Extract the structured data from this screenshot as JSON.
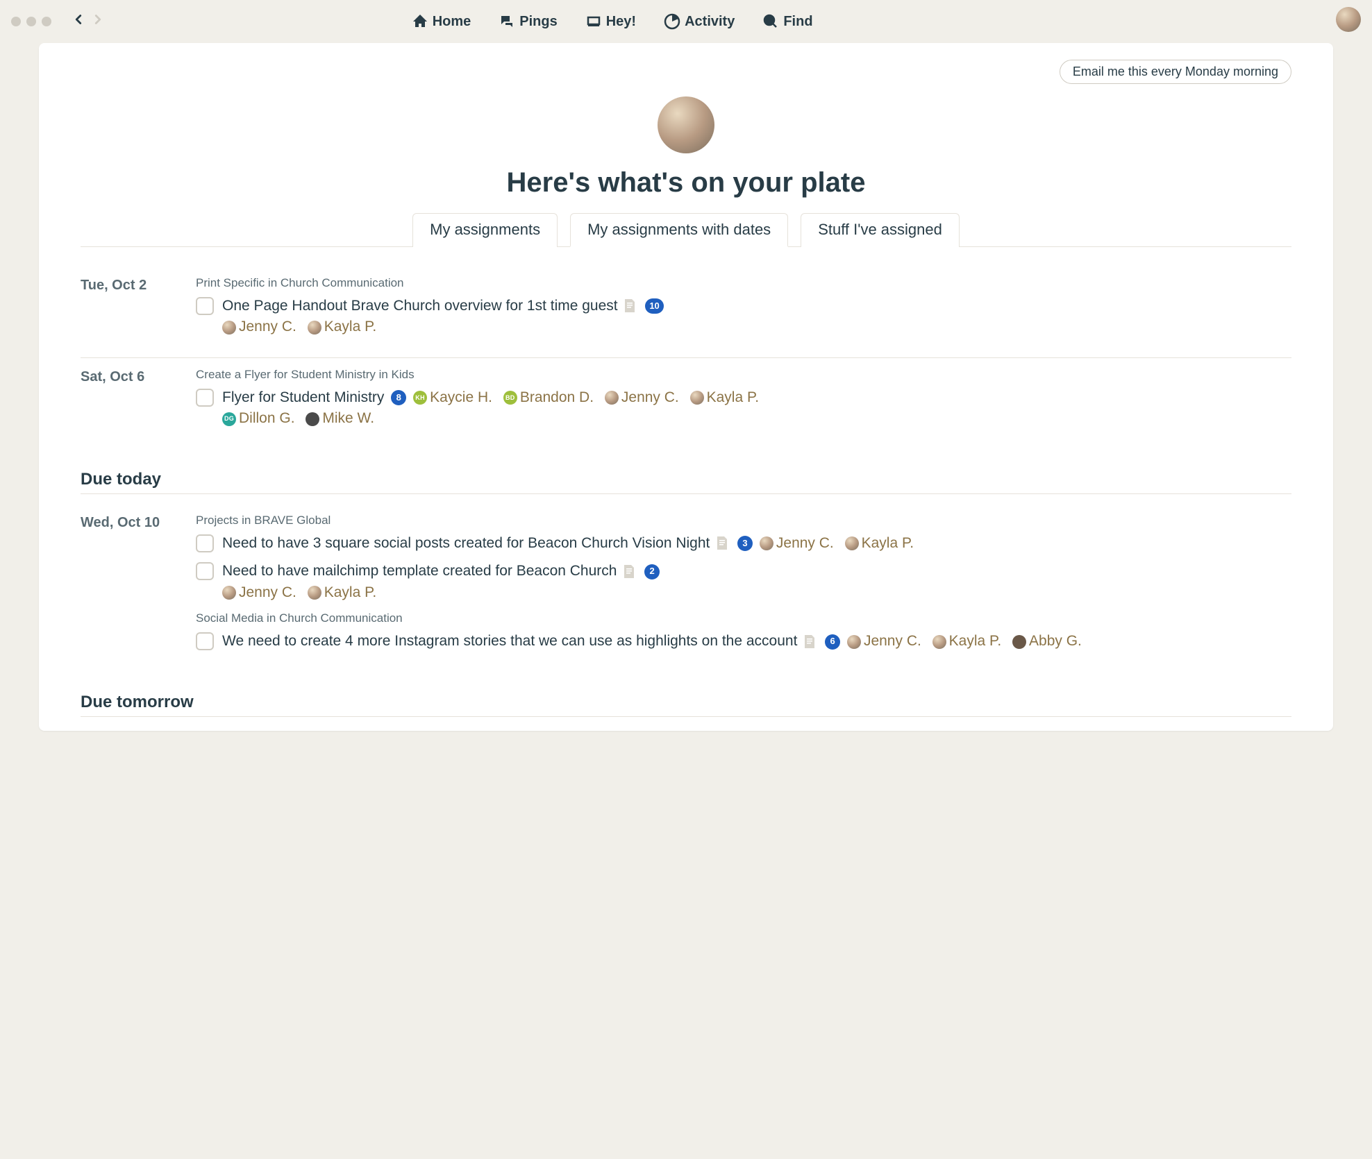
{
  "nav": {
    "home": "Home",
    "pings": "Pings",
    "hey": "Hey!",
    "activity": "Activity",
    "find": "Find"
  },
  "email_button": "Email me this every Monday morning",
  "page_title": "Here's what's on your plate",
  "tabs": {
    "my_assignments": "My assignments",
    "with_dates": "My assignments with dates",
    "stuff_assigned": "Stuff I've assigned"
  },
  "sections": {
    "due_today": "Due today",
    "due_tomorrow": "Due tomorrow"
  },
  "days": {
    "oct2": {
      "label": "Tue, Oct 2",
      "project1": "Print Specific in Church Communication",
      "task1": {
        "title": "One Page Handout Brave Church overview for 1st time guest",
        "count": "10",
        "assignees": {
          "a1": "Jenny C.",
          "a2": "Kayla P."
        }
      }
    },
    "oct6": {
      "label": "Sat, Oct 6",
      "project1": "Create a Flyer for Student Ministry in Kids",
      "task1": {
        "title": "Flyer for Student Ministry",
        "count": "8",
        "assignees": {
          "a1": "Kaycie H.",
          "a2": "Brandon D.",
          "a3": "Jenny C.",
          "a4": "Kayla P.",
          "a5": "Dillon G.",
          "a6": "Mike W."
        }
      }
    },
    "oct10": {
      "label": "Wed, Oct 10",
      "project1": "Projects in BRAVE Global",
      "task1": {
        "title": "Need to have 3 square social posts created for Beacon Church Vision Night",
        "count": "3",
        "assignees": {
          "a1": "Jenny C.",
          "a2": "Kayla P."
        }
      },
      "task2": {
        "title": "Need to have mailchimp template created for Beacon Church",
        "count": "2",
        "assignees": {
          "a1": "Jenny C.",
          "a2": "Kayla P."
        }
      },
      "project2": "Social Media in Church Communication",
      "task3": {
        "title": "We need to create 4 more Instagram stories that we can use as highlights on the account",
        "count": "6",
        "assignees": {
          "a1": "Jenny C.",
          "a2": "Kayla P.",
          "a3": "Abby G."
        }
      }
    }
  }
}
